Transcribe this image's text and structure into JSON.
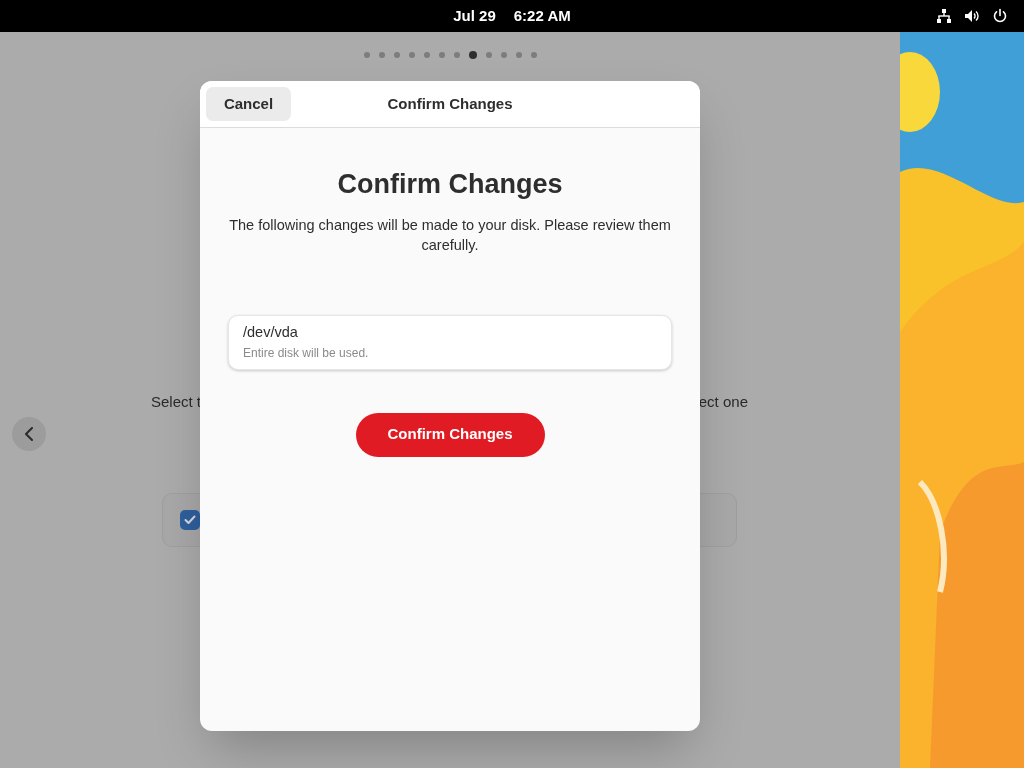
{
  "top_bar": {
    "date": "Jul 29",
    "time": "6:22 AM"
  },
  "page_indicator": [
    {
      "selected": false
    },
    {
      "selected": false
    },
    {
      "selected": false
    },
    {
      "selected": false
    },
    {
      "selected": false
    },
    {
      "selected": false
    },
    {
      "selected": false
    },
    {
      "selected": true
    },
    {
      "selected": false
    },
    {
      "selected": false
    },
    {
      "selected": false
    },
    {
      "selected": false
    }
  ],
  "background": {
    "text_left": "Select t",
    "text_right": "ect one",
    "option": {
      "checked": true
    }
  },
  "dialog": {
    "header_title": "Confirm Changes",
    "cancel_button": "Cancel",
    "title": "Confirm Changes",
    "description": "The following changes will be made to your disk. Please review them carefully.",
    "disks": [
      {
        "name": "/dev/vda",
        "detail": "Entire disk will be used."
      }
    ],
    "confirm_button": "Confirm Changes"
  }
}
